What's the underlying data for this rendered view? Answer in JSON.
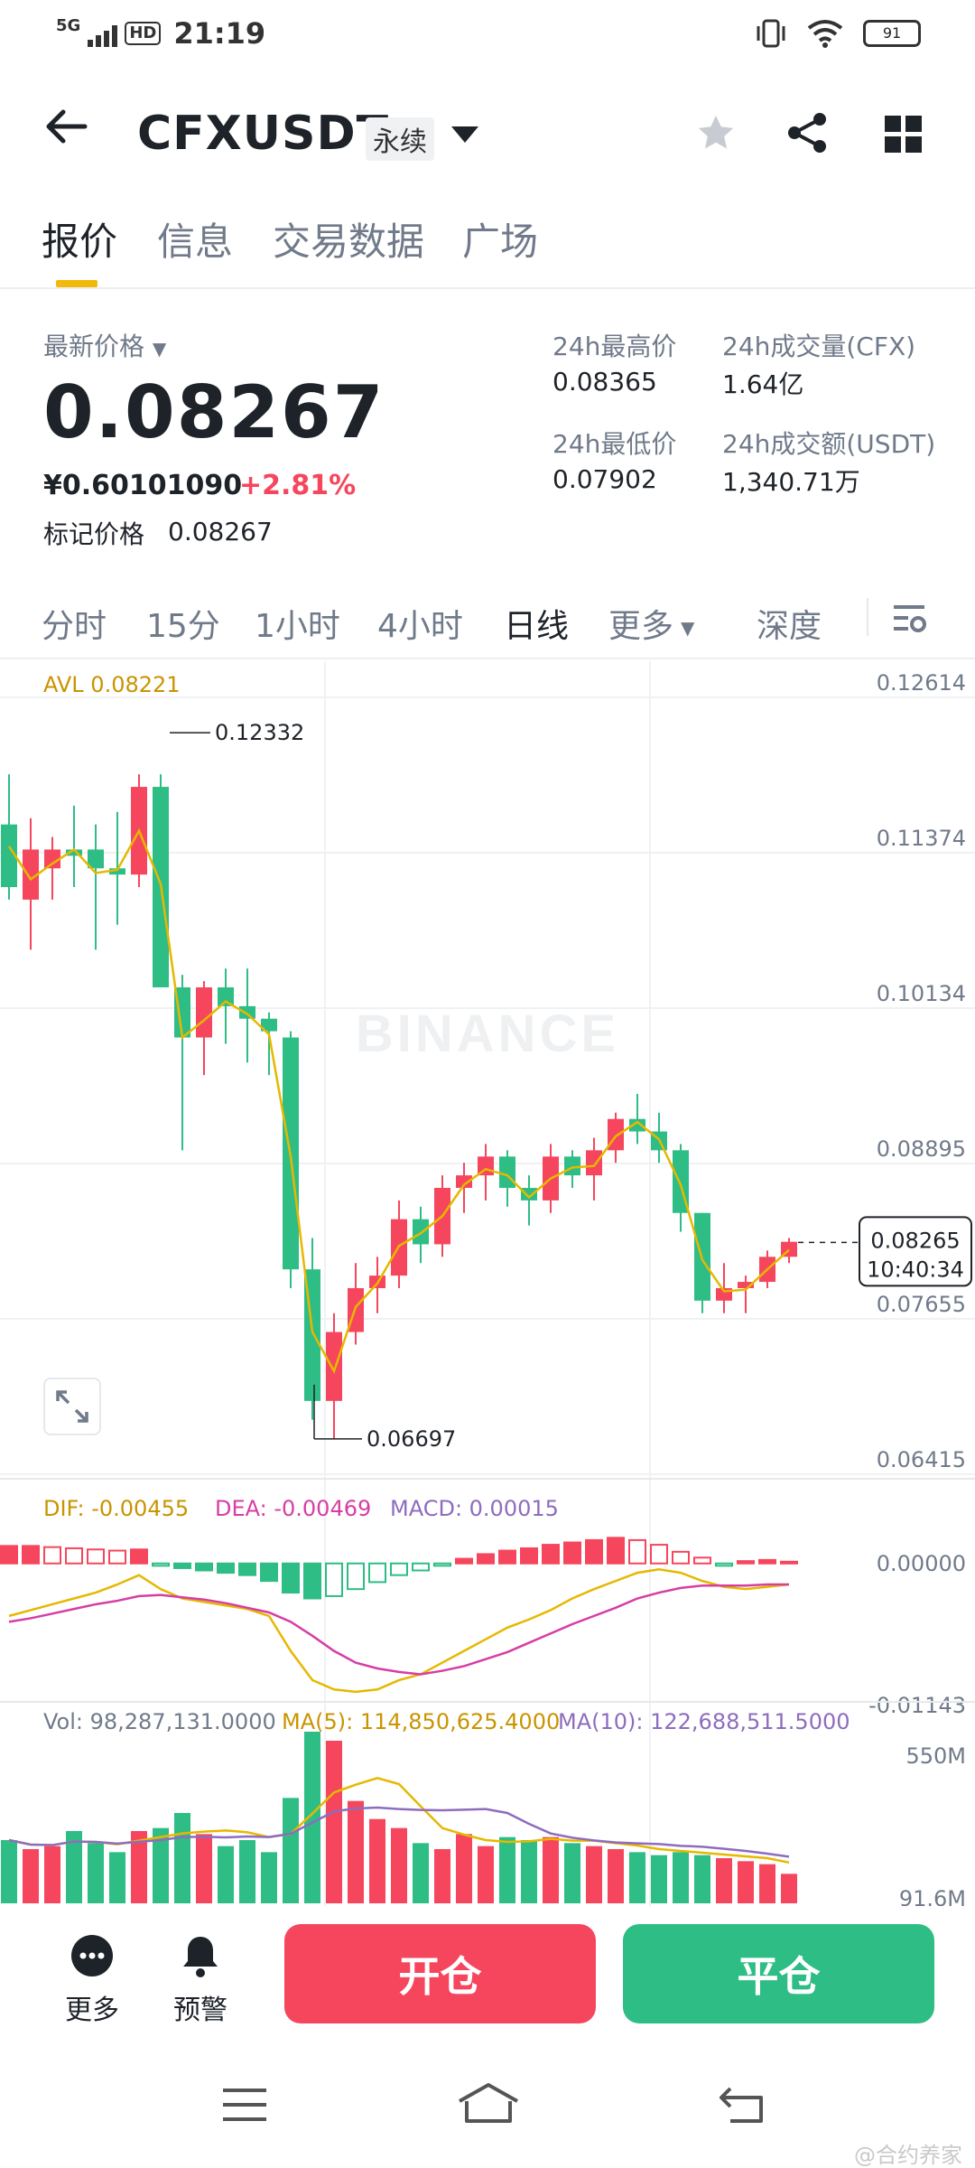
{
  "status_bar": {
    "network": "5G",
    "hd": "HD",
    "time": "21:19",
    "battery": "91"
  },
  "header": {
    "symbol": "CFXUSDT",
    "contract_type": "永续"
  },
  "tabs": [
    {
      "label": "报价",
      "active": true
    },
    {
      "label": "信息",
      "active": false
    },
    {
      "label": "交易数据",
      "active": false
    },
    {
      "label": "广场",
      "active": false
    }
  ],
  "price": {
    "latest_label": "最新价格",
    "latest": "0.08267",
    "cny": "¥0.60101090",
    "change": "+2.81%",
    "mark_label": "标记价格",
    "mark": "0.08267"
  },
  "stats": {
    "high_label": "24h最高价",
    "high": "0.08365",
    "vol_cfx_label": "24h成交量(CFX)",
    "vol_cfx": "1.64亿",
    "low_label": "24h最低价",
    "low": "0.07902",
    "vol_usdt_label": "24h成交额(USDT)",
    "vol_usdt": "1,340.71万"
  },
  "intervals": [
    {
      "label": "分时",
      "active": false
    },
    {
      "label": "15分",
      "active": false
    },
    {
      "label": "1小时",
      "active": false
    },
    {
      "label": "4小时",
      "active": false
    },
    {
      "label": "日线",
      "active": true
    },
    {
      "label": "更多",
      "active": false
    },
    {
      "label": "深度",
      "active": false
    }
  ],
  "chart_data": {
    "type": "candlestick",
    "indicator_label": "AVL 0.08221",
    "watermark": "BINANCE",
    "y_ticks": [
      "0.12614",
      "0.11374",
      "0.10134",
      "0.08895",
      "0.07655",
      "0.06415"
    ],
    "ylim": [
      0.06415,
      0.12614
    ],
    "high_marker": "0.12332",
    "low_marker": "0.06697",
    "current_price": "0.08265",
    "countdown": "10:40:34",
    "candles": [
      {
        "o": 0.116,
        "h": 0.12,
        "l": 0.11,
        "c": 0.111
      },
      {
        "o": 0.11,
        "h": 0.1165,
        "l": 0.106,
        "c": 0.114
      },
      {
        "o": 0.1125,
        "h": 0.115,
        "l": 0.11,
        "c": 0.114
      },
      {
        "o": 0.114,
        "h": 0.1175,
        "l": 0.111,
        "c": 0.1135
      },
      {
        "o": 0.114,
        "h": 0.116,
        "l": 0.106,
        "c": 0.1125
      },
      {
        "o": 0.1125,
        "h": 0.117,
        "l": 0.108,
        "c": 0.112
      },
      {
        "o": 0.112,
        "h": 0.12,
        "l": 0.111,
        "c": 0.119
      },
      {
        "o": 0.119,
        "h": 0.12,
        "l": 0.103,
        "c": 0.103
      },
      {
        "o": 0.103,
        "h": 0.104,
        "l": 0.09,
        "c": 0.099
      },
      {
        "o": 0.099,
        "h": 0.1035,
        "l": 0.096,
        "c": 0.103
      },
      {
        "o": 0.103,
        "h": 0.1045,
        "l": 0.0985,
        "c": 0.1015
      },
      {
        "o": 0.1015,
        "h": 0.1045,
        "l": 0.097,
        "c": 0.1005
      },
      {
        "o": 0.1005,
        "h": 0.101,
        "l": 0.096,
        "c": 0.0995
      },
      {
        "o": 0.099,
        "h": 0.0995,
        "l": 0.079,
        "c": 0.0805
      },
      {
        "o": 0.0805,
        "h": 0.083,
        "l": 0.0685,
        "c": 0.07
      },
      {
        "o": 0.07,
        "h": 0.077,
        "l": 0.067,
        "c": 0.0755
      },
      {
        "o": 0.0755,
        "h": 0.081,
        "l": 0.0745,
        "c": 0.079
      },
      {
        "o": 0.079,
        "h": 0.0815,
        "l": 0.077,
        "c": 0.08
      },
      {
        "o": 0.08,
        "h": 0.086,
        "l": 0.079,
        "c": 0.0845
      },
      {
        "o": 0.0845,
        "h": 0.0855,
        "l": 0.081,
        "c": 0.0825
      },
      {
        "o": 0.0825,
        "h": 0.088,
        "l": 0.0815,
        "c": 0.087
      },
      {
        "o": 0.087,
        "h": 0.089,
        "l": 0.085,
        "c": 0.088
      },
      {
        "o": 0.088,
        "h": 0.0905,
        "l": 0.086,
        "c": 0.0895
      },
      {
        "o": 0.0895,
        "h": 0.09,
        "l": 0.0855,
        "c": 0.087
      },
      {
        "o": 0.087,
        "h": 0.088,
        "l": 0.084,
        "c": 0.086
      },
      {
        "o": 0.086,
        "h": 0.0905,
        "l": 0.085,
        "c": 0.0895
      },
      {
        "o": 0.0895,
        "h": 0.09,
        "l": 0.087,
        "c": 0.088
      },
      {
        "o": 0.088,
        "h": 0.091,
        "l": 0.086,
        "c": 0.09
      },
      {
        "o": 0.09,
        "h": 0.093,
        "l": 0.089,
        "c": 0.0925
      },
      {
        "o": 0.0925,
        "h": 0.0945,
        "l": 0.0905,
        "c": 0.0915
      },
      {
        "o": 0.0915,
        "h": 0.093,
        "l": 0.089,
        "c": 0.09
      },
      {
        "o": 0.09,
        "h": 0.0905,
        "l": 0.0835,
        "c": 0.085
      },
      {
        "o": 0.085,
        "h": 0.085,
        "l": 0.077,
        "c": 0.078
      },
      {
        "o": 0.078,
        "h": 0.081,
        "l": 0.077,
        "c": 0.079
      },
      {
        "o": 0.079,
        "h": 0.08,
        "l": 0.077,
        "c": 0.0795
      },
      {
        "o": 0.0795,
        "h": 0.082,
        "l": 0.079,
        "c": 0.0815
      },
      {
        "o": 0.0815,
        "h": 0.083,
        "l": 0.081,
        "c": 0.0827
      }
    ],
    "macd": {
      "dif_label": "DIF: -0.00455",
      "dea_label": "DEA: -0.00469",
      "macd_label": "MACD: 0.00015",
      "y_ticks": [
        "0.00000",
        "-0.01143"
      ],
      "ylim": [
        -0.01143,
        0.0
      ],
      "histogram": [
        0.0015,
        0.0015,
        0.0014,
        0.0013,
        0.0012,
        0.0011,
        0.0012,
        -0.0002,
        -0.0004,
        -0.0006,
        -0.0008,
        -0.001,
        -0.0015,
        -0.0025,
        -0.003,
        -0.0028,
        -0.0022,
        -0.0016,
        -0.001,
        -0.0006,
        -0.0002,
        0.0004,
        0.0008,
        0.0011,
        0.0013,
        0.0016,
        0.0018,
        0.002,
        0.0022,
        0.002,
        0.0016,
        0.001,
        0.0005,
        -0.0002,
        0.0002,
        0.0003,
        0.00015
      ],
      "dif": [
        -0.0045,
        -0.004,
        -0.0035,
        -0.003,
        -0.0025,
        -0.0018,
        -0.001,
        -0.0022,
        -0.003,
        -0.0033,
        -0.0036,
        -0.0039,
        -0.0045,
        -0.0075,
        -0.01,
        -0.0108,
        -0.011,
        -0.0108,
        -0.01,
        -0.0095,
        -0.0085,
        -0.0075,
        -0.0065,
        -0.0055,
        -0.0048,
        -0.004,
        -0.003,
        -0.0022,
        -0.0015,
        -0.0008,
        -0.0005,
        -0.0008,
        -0.0015,
        -0.002,
        -0.0022,
        -0.002,
        -0.0018
      ],
      "dea": [
        -0.005,
        -0.0047,
        -0.0043,
        -0.0039,
        -0.0035,
        -0.0032,
        -0.0028,
        -0.0027,
        -0.0029,
        -0.0031,
        -0.0034,
        -0.0038,
        -0.0042,
        -0.005,
        -0.0062,
        -0.0075,
        -0.0085,
        -0.009,
        -0.0093,
        -0.0095,
        -0.0092,
        -0.0088,
        -0.0082,
        -0.0076,
        -0.0068,
        -0.006,
        -0.0052,
        -0.0045,
        -0.0038,
        -0.003,
        -0.0025,
        -0.0021,
        -0.0019,
        -0.0019,
        -0.0019,
        -0.0018,
        -0.0018
      ]
    },
    "volume": {
      "vol_label": "Vol: 98,287,131.0000",
      "ma5_label": "MA(5): 114,850,625.4000",
      "ma10_label": "MA(10): 122,688,511.5000",
      "y_ticks": [
        "550M",
        "91.6M"
      ],
      "values": [
        210,
        180,
        190,
        240,
        200,
        170,
        240,
        250,
        300,
        230,
        190,
        210,
        170,
        350,
        570,
        540,
        340,
        280,
        250,
        200,
        180,
        230,
        190,
        220,
        210,
        220,
        200,
        190,
        180,
        170,
        160,
        170,
        160,
        150,
        140,
        130,
        98
      ]
    }
  },
  "footer": {
    "more": "更多",
    "alert": "预警",
    "open": "开仓",
    "close": "平仓"
  },
  "watermark_credit": "@合约养家",
  "colors": {
    "up": "#f6465d",
    "down": "#2ebd85",
    "accent": "#f0b90b",
    "ma": "#e6b800",
    "dea": "#d63ea5",
    "ma10": "#8e6cbe"
  }
}
